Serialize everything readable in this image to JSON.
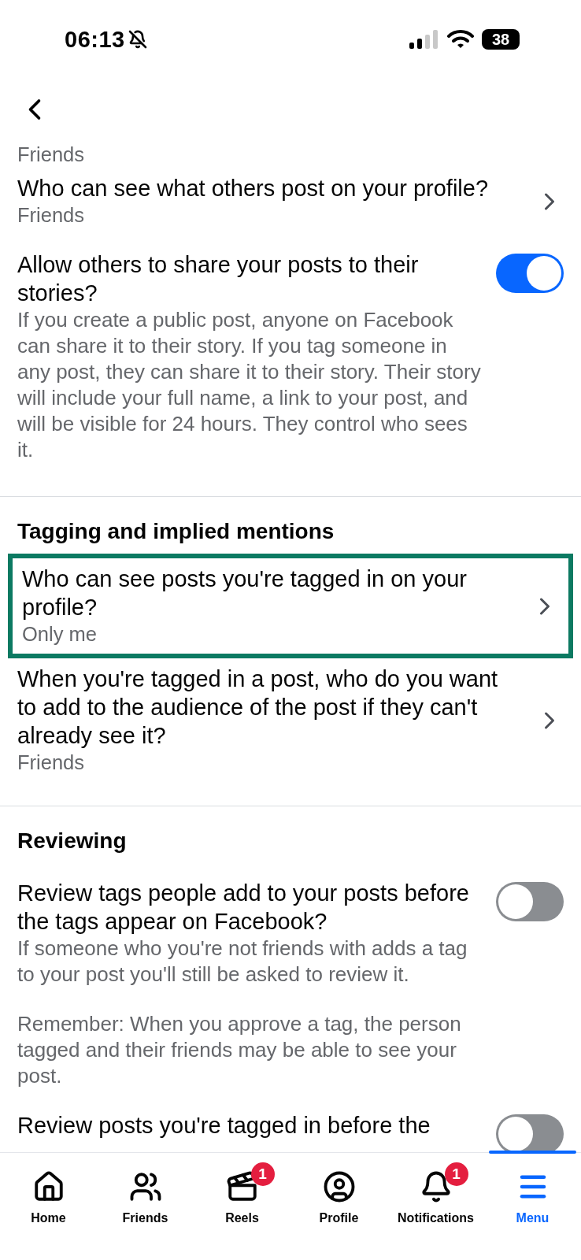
{
  "status_bar": {
    "time": "06:13",
    "battery": "38"
  },
  "sections": [
    {
      "items": [
        {
          "kind": "value",
          "value": "Friends"
        },
        {
          "kind": "link",
          "title": "Who can see what others post on your profile?",
          "value": "Friends",
          "highlighted": false
        },
        {
          "kind": "toggle",
          "title": "Allow others to share your posts to their stories?",
          "description": [
            "If you create a public post, anyone on Facebook can share it to their story. If you tag someone in any post, they can share it to their story. Their story will include your full name, a link to your post, and will be visible for 24 hours. They control who sees it."
          ],
          "on": true
        }
      ]
    },
    {
      "heading": "Tagging and implied mentions",
      "items": [
        {
          "kind": "link",
          "title": "Who can see posts you're tagged in on your profile?",
          "value": "Only me",
          "highlighted": true
        },
        {
          "kind": "link",
          "title": "When you're tagged in a post, who do you want to add to the audience of the post if they can't already see it?",
          "value": "Friends",
          "highlighted": false
        }
      ]
    },
    {
      "heading": "Reviewing",
      "items": [
        {
          "kind": "toggle",
          "title": "Review tags people add to your posts before the tags appear on Facebook?",
          "description": [
            "If someone who you're not friends with adds a tag to your post you'll still be asked to review it.",
            "Remember: When you approve a tag, the person tagged and their friends may be able to see your post."
          ],
          "on": false
        },
        {
          "kind": "toggle",
          "title": "Review posts you're tagged in before the",
          "on": false
        }
      ]
    }
  ],
  "tabs": [
    {
      "label": "Home",
      "selected": false
    },
    {
      "label": "Friends",
      "selected": false
    },
    {
      "label": "Reels",
      "badge": "1",
      "selected": false
    },
    {
      "label": "Profile",
      "selected": false
    },
    {
      "label": "Notifications",
      "badge": "1",
      "selected": false
    },
    {
      "label": "Menu",
      "selected": true
    }
  ]
}
